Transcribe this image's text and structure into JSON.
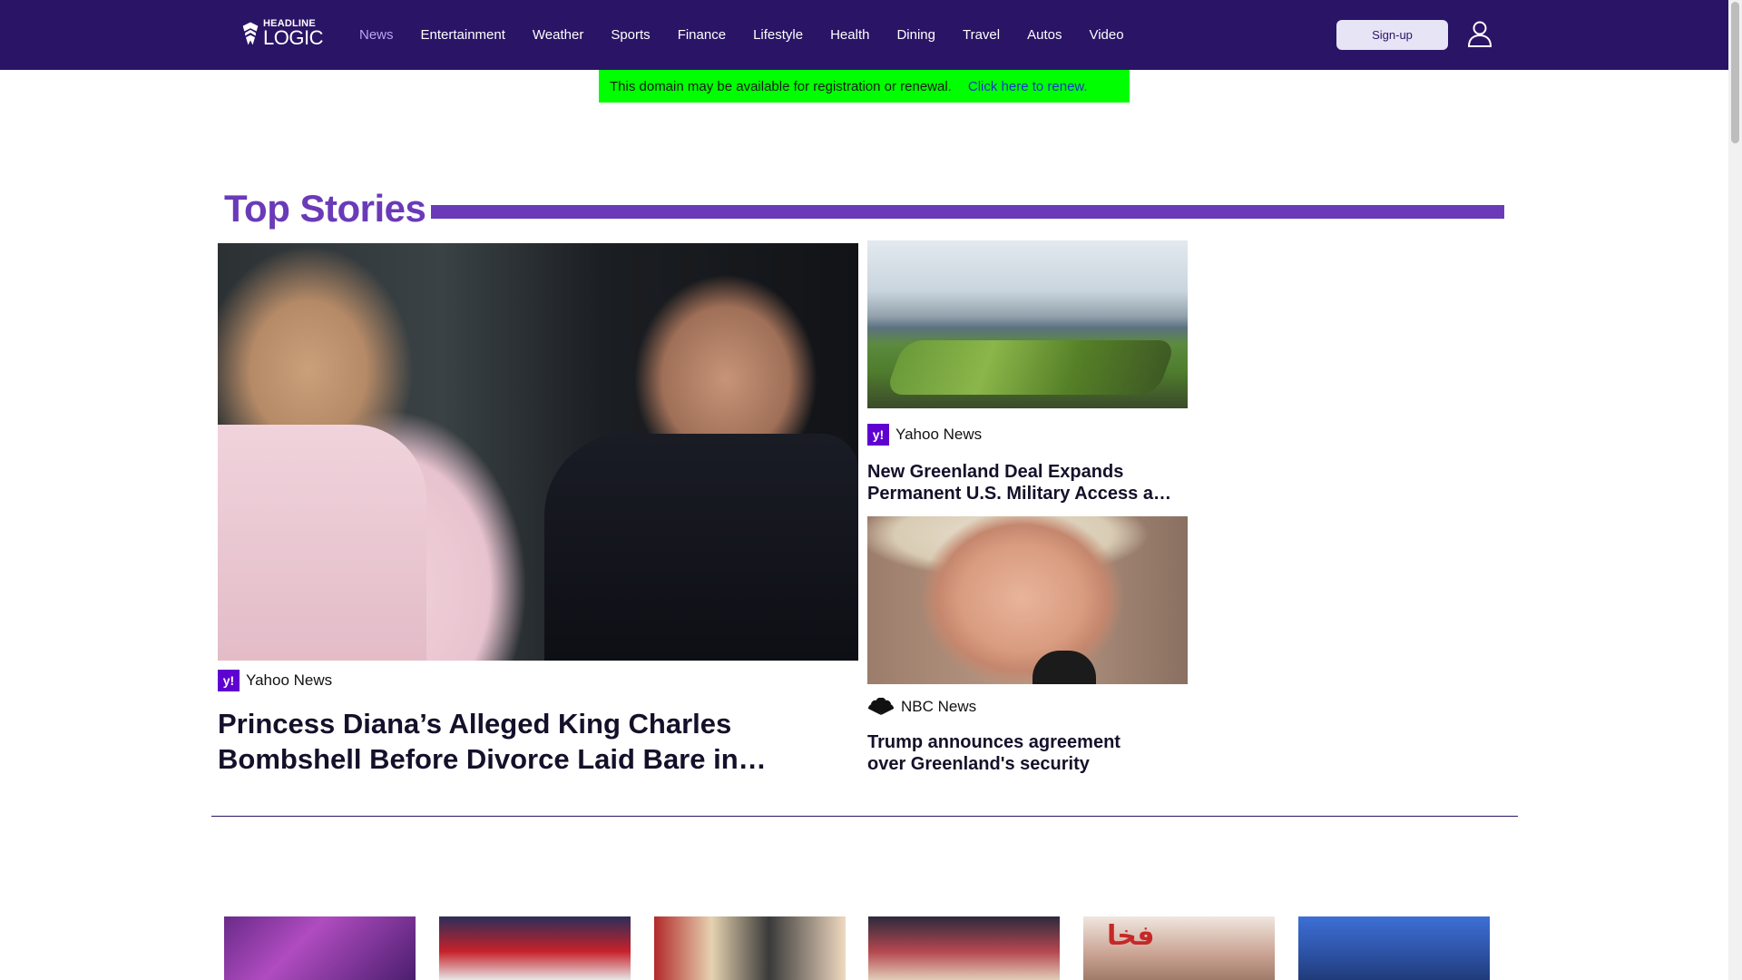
{
  "header": {
    "logo_small": "HEADLINE",
    "logo_big": "LOGIC",
    "nav": [
      {
        "label": "News",
        "active": true
      },
      {
        "label": "Entertainment"
      },
      {
        "label": "Weather"
      },
      {
        "label": "Sports"
      },
      {
        "label": "Finance"
      },
      {
        "label": "Lifestyle"
      },
      {
        "label": "Health"
      },
      {
        "label": "Dining"
      },
      {
        "label": "Travel"
      },
      {
        "label": "Autos"
      },
      {
        "label": "Video"
      }
    ],
    "signup_label": "Sign-up",
    "user_icon": "user-icon"
  },
  "banner": {
    "message": "This domain may be available for registration or renewal.",
    "link": "Click here to renew."
  },
  "top_stories": {
    "title": "Top Stories",
    "hero": {
      "source": "Yahoo News",
      "headline": "Princess Diana’s Alleged King Charles Bombshell Before Divorce Laid Bare in New Book"
    },
    "side": [
      {
        "source": "Yahoo News",
        "headline": "New Greenland Deal Expands Permanent U.S. Military Access and Base Rights"
      },
      {
        "source": "NBC News",
        "headline": "Trump announces agreement over Greenland's security"
      }
    ]
  },
  "thumb_text": "فخا",
  "colors": {
    "header_bg": "#2a1466",
    "accent": "#6a3ab8",
    "banner_bg": "#00ff00",
    "yahoo": "#5f01d1"
  }
}
